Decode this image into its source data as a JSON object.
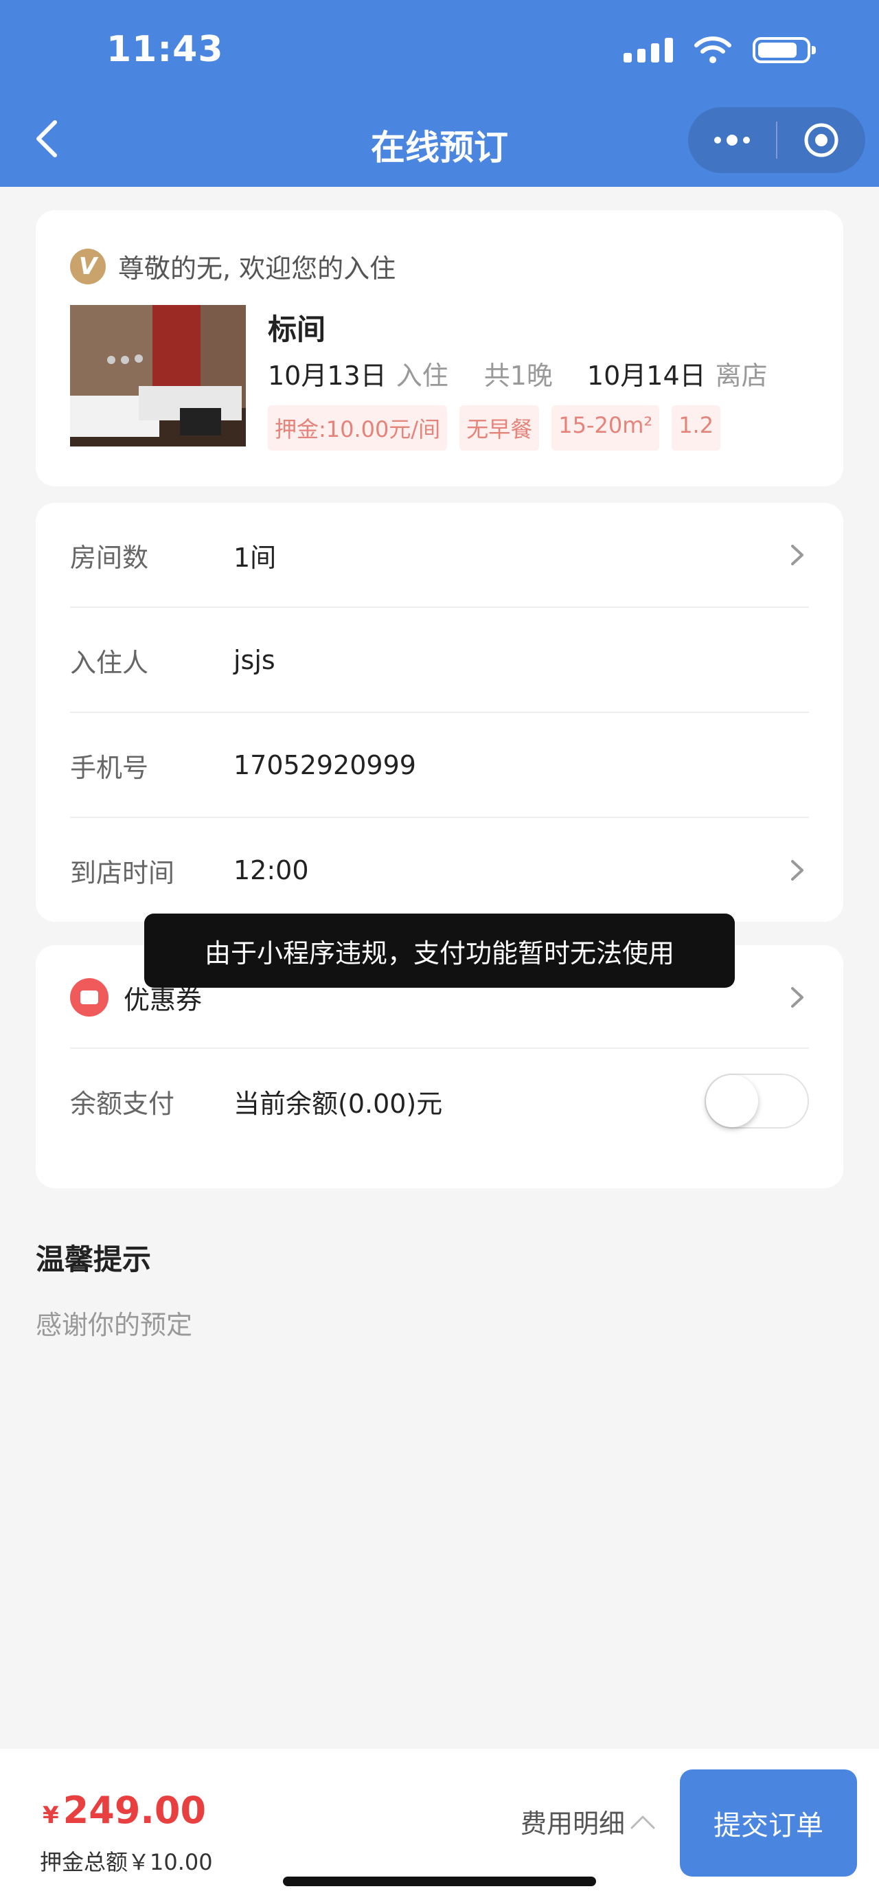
{
  "status_bar": {
    "time": "11:43"
  },
  "nav": {
    "title": "在线预订"
  },
  "hotel": {
    "welcome": "尊敬的无, 欢迎您的入住",
    "room_name": "标间",
    "checkin_date": "10月13日",
    "checkin_label": "入住",
    "nights": "共1晚",
    "checkout_date": "10月14日",
    "checkout_label": "离店",
    "tags": [
      "押金:10.00元/间",
      "无早餐",
      "15-20m²",
      "1.2"
    ]
  },
  "form": {
    "rooms": {
      "label": "房间数",
      "value": "1间"
    },
    "guest": {
      "label": "入住人",
      "value": "jsjs"
    },
    "phone": {
      "label": "手机号",
      "value": "17052920999"
    },
    "arrival": {
      "label": "到店时间",
      "value": "12:00"
    }
  },
  "payment": {
    "coupon_label": "优惠券",
    "balance_label": "余额支付",
    "balance_value": "当前余额(0.00)元",
    "balance_enabled": false
  },
  "toast": "由于小程序违规，支付功能暂时无法使用",
  "tips": {
    "title": "温馨提示",
    "text": "感谢你的预定"
  },
  "bottom": {
    "currency": "¥",
    "total": "249.00",
    "deposit": "押金总额￥10.00",
    "fee_detail": "费用明细",
    "submit": "提交订单"
  },
  "colors": {
    "primary": "#4a86e0",
    "price": "#e84040",
    "tag_bg": "#fdf0ee",
    "tag_text": "#e5837a"
  }
}
